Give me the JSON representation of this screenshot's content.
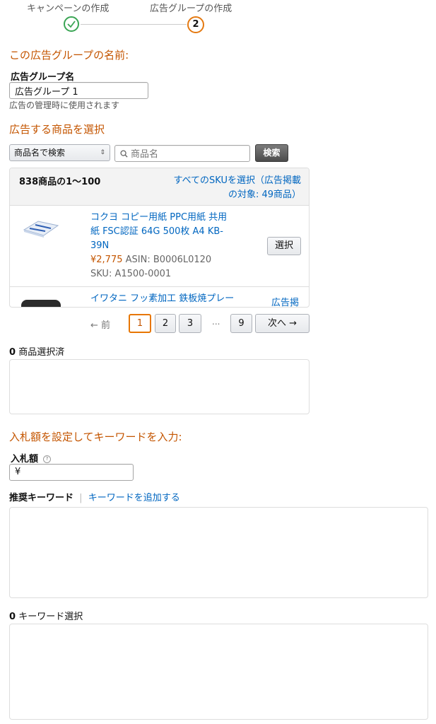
{
  "stepper": {
    "step1_label": "キャンペーンの作成",
    "step1_icon": "check-icon",
    "step2_label": "広告グループの作成",
    "step2_number": "2"
  },
  "ad_group": {
    "section_title": "この広告グループの名前:",
    "name_label": "広告グループ名",
    "name_value": "広告グループ 1",
    "helper": "広告の管理時に使用されます"
  },
  "products": {
    "section_title": "広告する商品を選択",
    "search_mode": "商品名で検索",
    "search_placeholder": "商品名",
    "search_button": "検索",
    "results_count": "838商品の1〜100",
    "select_all_line1": "すべてのSKUを選択（広告掲載",
    "select_all_line2": "の対象: 49商品）",
    "items": [
      {
        "title_line1": "コクヨ コピー用紙 PPC用紙 共用",
        "title_line2": "紙 FSC認証 64G 500枚 A4 KB-",
        "title_line3": "39N",
        "price": "¥2,775",
        "asin": "ASIN: B0006L0120",
        "sku": "SKU: A1500-0001",
        "select_label": "選択",
        "thumbnail_icon": "paper-ream-icon"
      },
      {
        "title_line1": "イワタニ フッ素加工 鉄板焼プレー",
        "status_label": "広告掲",
        "thumbnail_icon": "grill-plate-icon"
      }
    ],
    "pagination": {
      "prev": "← 前",
      "pages": [
        "1",
        "2",
        "3"
      ],
      "ellipsis": "...",
      "last_page": "9",
      "next": "次へ →",
      "current": "1"
    },
    "selected_count": "0",
    "selected_label": "商品選択済"
  },
  "keywords": {
    "section_title": "入札額を設定してキーワードを入力:",
    "bid_label": "入札額",
    "help_icon": "question-circle-icon",
    "bid_currency": "¥",
    "bid_value": "",
    "suggested_label": "推奨キーワード",
    "divider": "|",
    "add_keywords_link": "キーワードを追加する",
    "selected_count": "0",
    "selected_label": "キーワード選択"
  },
  "colors": {
    "accent": "#c45500",
    "link": "#0066c0",
    "success": "#3aa554",
    "active_step": "#e47911"
  }
}
